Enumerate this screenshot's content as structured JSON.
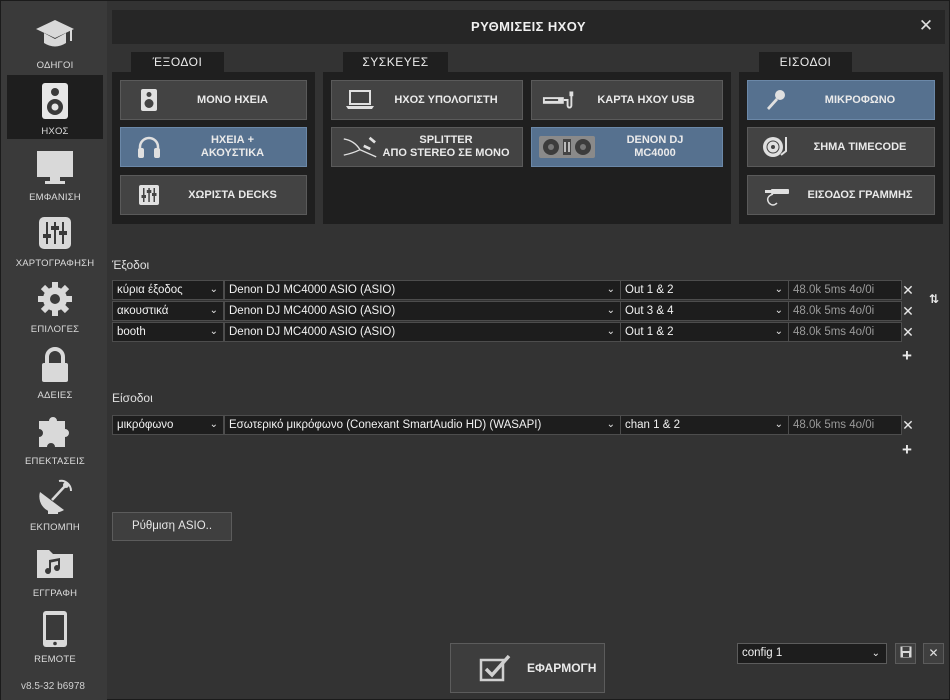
{
  "window": {
    "title": "ΡΥΘΜΙΣΕΙΣ ΗΧΟΥ",
    "close_glyph": "✕"
  },
  "sidebar": {
    "items": [
      {
        "label": "ΟΔΗΓΟΙ",
        "icon": "graduation-cap-icon",
        "active": false
      },
      {
        "label": "ΗΧΟΣ",
        "icon": "speaker-icon",
        "active": true
      },
      {
        "label": "ΕΜΦΑΝΙΣΗ",
        "icon": "monitor-icon",
        "active": false
      },
      {
        "label": "ΧΑΡΤΟΓΡΑΦΗΣΗ",
        "icon": "mixer-sliders-icon",
        "active": false
      },
      {
        "label": "ΕΠΙΛΟΓΕΣ",
        "icon": "gear-icon",
        "active": false
      },
      {
        "label": "ΑΔΕΙΕΣ",
        "icon": "lock-icon",
        "active": false
      },
      {
        "label": "ΕΠΕΚΤΑΣΕΙΣ",
        "icon": "puzzle-icon",
        "active": false
      },
      {
        "label": "ΕΚΠΟΜΠΗ",
        "icon": "broadcast-dish-icon",
        "active": false
      },
      {
        "label": "ΕΓΓΡΑΦΗ",
        "icon": "music-folder-icon",
        "active": false
      },
      {
        "label": "REMOTE",
        "icon": "tablet-icon",
        "active": false
      }
    ],
    "version": "v8.5-32 b6978"
  },
  "groups": {
    "outputs": {
      "tab": "ΈΞΟΔΟΙ",
      "buttons": [
        {
          "label": "ΜΟΝΟ ΗΧΕΙΑ",
          "icon": "speaker-icon",
          "selected": false
        },
        {
          "label": "ΗΧΕΙΑ +\nΑΚΟΥΣΤΙΚΑ",
          "icon": "headphones-icon",
          "selected": true
        },
        {
          "label": "ΧΩΡΙΣΤΑ DECKS",
          "icon": "mixer-sliders-icon",
          "selected": false
        }
      ]
    },
    "devices": {
      "tab": "ΣΥΣΚΕΥΕΣ",
      "buttons": [
        {
          "label": "ΗΧΟΣ ΥΠΟΛΟΓΙΣΤΗ",
          "icon": "laptop-icon",
          "selected": false
        },
        {
          "label": "ΚΑΡΤΑ ΗΧΟΥ USB",
          "icon": "usb-soundcard-icon",
          "selected": false
        },
        {
          "label": "SPLITTER\nΑΠΟ STEREO ΣΕ ΜΟΝΟ",
          "icon": "splitter-cable-icon",
          "selected": false
        },
        {
          "label": "DENON DJ\nMC4000",
          "icon": "dj-controller-icon",
          "selected": true
        }
      ]
    },
    "inputs": {
      "tab": "ΕΙΣΟΔΟΙ",
      "buttons": [
        {
          "label": "ΜΙΚΡΟΦΩΝΟ",
          "icon": "microphone-icon",
          "selected": true
        },
        {
          "label": "ΣΗΜΑ TIMECODE",
          "icon": "turntable-icon",
          "selected": false
        },
        {
          "label": "ΕΙΣΟΔΟΣ ΓΡΑΜΜΗΣ",
          "icon": "rca-cable-icon",
          "selected": false
        }
      ]
    }
  },
  "outputs_section": {
    "title": "Έξοδοι",
    "rows": [
      {
        "role": "κύρια έξοδος",
        "device": "Denon DJ MC4000 ASIO (ASIO)",
        "channels": "Out 1 & 2",
        "info": "48.0k 5ms 4o/0i"
      },
      {
        "role": "ακουστικά",
        "device": "Denon DJ MC4000 ASIO (ASIO)",
        "channels": "Out 3 & 4",
        "info": "48.0k 5ms 4o/0i"
      },
      {
        "role": "booth",
        "device": "Denon DJ MC4000 ASIO (ASIO)",
        "channels": "Out 1 & 2",
        "info": "48.0k 5ms 4o/0i"
      }
    ]
  },
  "inputs_section": {
    "title": "Είσοδοι",
    "rows": [
      {
        "role": "μικρόφωνο",
        "device": "Εσωτερικό μικρόφωνο (Conexant SmartAudio HD) (WASAPI)",
        "channels": "chan 1 & 2",
        "info": "48.0k 5ms 4o/0i"
      }
    ]
  },
  "asio_button": "Ρύθμιση ASIO..",
  "apply_button": "ΕΦΑΡΜΟΓΗ",
  "config": {
    "value": "config 1"
  },
  "glyphs": {
    "remove": "✕",
    "add": "+",
    "chevron": "⌄",
    "swap": "⇅"
  }
}
